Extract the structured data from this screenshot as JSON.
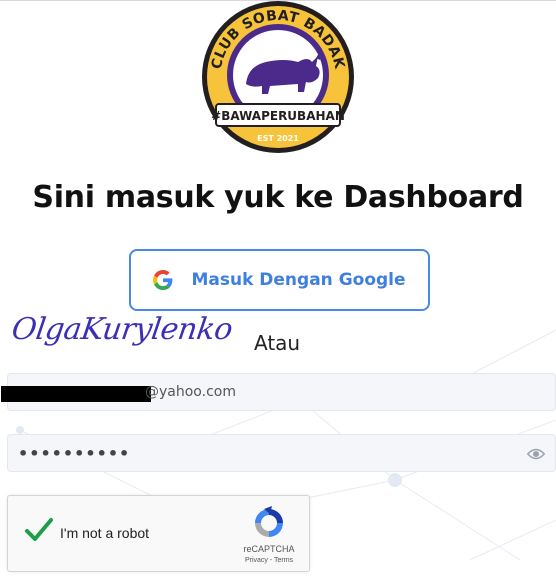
{
  "logo": {
    "top_text": "CLUB SOBAT BADAK",
    "banner_text": "#BAWAPERUBAHAN",
    "est_text": "EST 2021"
  },
  "heading": "Sini masuk yuk ke Dashboard",
  "google_button": {
    "label": "Masuk Dengan Google",
    "icon": "google-g-icon"
  },
  "watermark": "OlgaKurylenko",
  "divider_text": "Atau",
  "email_field": {
    "visible_suffix": "@yahoo.com"
  },
  "password_field": {
    "value": "••••••••••",
    "icon": "eye-icon"
  },
  "recaptcha": {
    "label": "I'm not a robot",
    "brand": "reCAPTCHA",
    "privacy": "Privacy",
    "separator": " - ",
    "terms": "Terms"
  },
  "colors": {
    "accent_blue": "#4a88e8",
    "logo_purple": "#4b2a8c",
    "logo_yellow": "#f6c33b",
    "check_green": "#1e9e4a"
  }
}
